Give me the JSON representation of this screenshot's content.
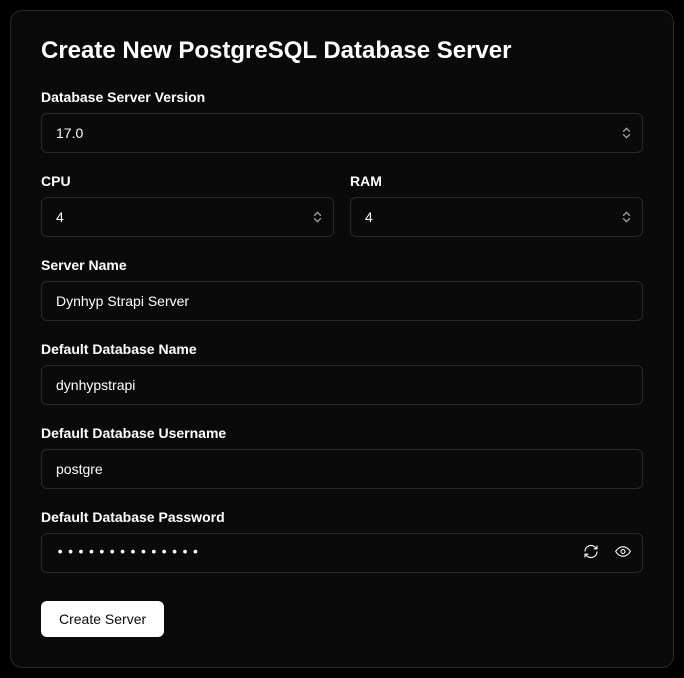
{
  "title": "Create New PostgreSQL Database Server",
  "fields": {
    "version": {
      "label": "Database Server Version",
      "value": "17.0"
    },
    "cpu": {
      "label": "CPU",
      "value": "4"
    },
    "ram": {
      "label": "RAM",
      "value": "4"
    },
    "serverName": {
      "label": "Server Name",
      "value": "Dynhyp Strapi Server"
    },
    "dbName": {
      "label": "Default Database Name",
      "value": "dynhypstrapi"
    },
    "dbUser": {
      "label": "Default Database Username",
      "value": "postgre"
    },
    "dbPassword": {
      "label": "Default Database Password",
      "value": "••••••••••••••"
    }
  },
  "submit": {
    "label": "Create Server"
  }
}
